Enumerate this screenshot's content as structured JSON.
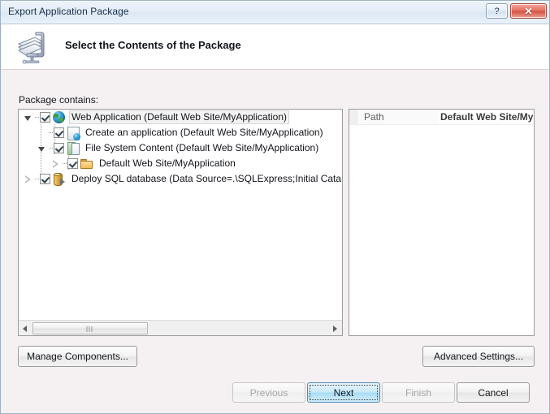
{
  "window": {
    "title": "Export Application Package",
    "help_button": "?",
    "close_button": "✕"
  },
  "header": {
    "title": "Select the Contents of the Package",
    "icon": "package-compress-icon"
  },
  "main": {
    "package_label": "Package contains:",
    "tree": [
      {
        "label": "Web Application (Default Web Site/MyApplication)",
        "icon": "globe-icon",
        "checked": true,
        "expanded": true,
        "depth": 0,
        "selected": true
      },
      {
        "label": "Create an application (Default Web Site/MyApplication)",
        "icon": "page-globe-icon",
        "checked": true,
        "expanded": null,
        "depth": 1,
        "selected": false
      },
      {
        "label": "File System Content (Default Web Site/MyApplication)",
        "icon": "documents-icon",
        "checked": true,
        "expanded": true,
        "depth": 1,
        "selected": false
      },
      {
        "label": "Default Web Site/MyApplication",
        "icon": "folder-icon",
        "checked": true,
        "expanded": false,
        "depth": 2,
        "selected": false
      },
      {
        "label": "Deploy SQL database (Data Source=.\\SQLExpress;Initial Catalog=",
        "icon": "database-icon",
        "checked": true,
        "expanded": false,
        "depth": 0,
        "selected": false
      }
    ],
    "scrollbar": {
      "left_arrow": "◀",
      "right_arrow": "▶",
      "thumb_percent": 37
    },
    "properties": [
      {
        "name": "Path",
        "value": "Default Web Site/My"
      }
    ]
  },
  "buttons": {
    "manage_components": "Manage Components...",
    "advanced_settings": "Advanced Settings...",
    "previous": "Previous",
    "next": "Next",
    "finish": "Finish",
    "cancel": "Cancel"
  }
}
